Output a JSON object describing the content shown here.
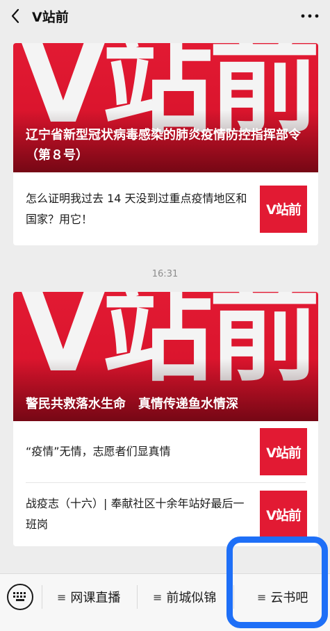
{
  "header": {
    "title": "V站前"
  },
  "cards": [
    {
      "banner_logo": "V站前",
      "headline": "辽宁省新型冠状病毒感染的肺炎疫情防控指挥部令（第８号）",
      "items": [
        {
          "text": "怎么证明我过去 14 天没到过重点疫情地区和国家？用它！",
          "thumb": "V站前"
        }
      ]
    },
    {
      "banner_logo": "V站前",
      "headline": "警民共救落水生命　真情传递鱼水情深",
      "items": [
        {
          "text": "“疫情”无情，志愿者们显真情",
          "thumb": "V站前"
        },
        {
          "text": "战疫志（十六）| 奉献社区十余年站好最后一班岗",
          "thumb": "V站前"
        }
      ]
    }
  ],
  "timestamp": "16:31",
  "bottom_menu": {
    "items": [
      {
        "label": "网课直播"
      },
      {
        "label": "前城似锦"
      },
      {
        "label": "云书吧"
      }
    ]
  },
  "colors": {
    "brand_red": "#e21a33",
    "highlight_blue": "#1e6ff7",
    "background": "#ededed"
  }
}
